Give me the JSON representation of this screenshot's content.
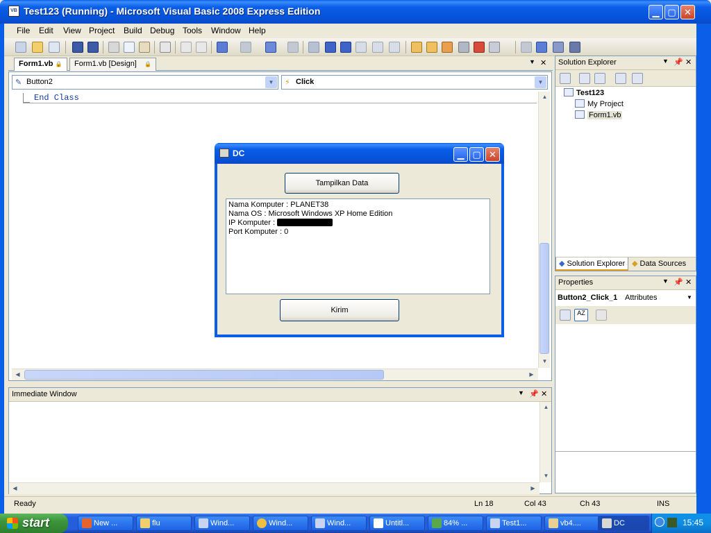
{
  "window": {
    "title": "Test123 (Running) - Microsoft Visual Basic 2008 Express Edition",
    "icon_text": "VB",
    "minimize_glyph": "▁",
    "maximize_glyph": "▢",
    "close_glyph": "✕"
  },
  "menu": [
    "File",
    "Edit",
    "View",
    "Project",
    "Build",
    "Debug",
    "Tools",
    "Window",
    "Help"
  ],
  "doc_tabs": [
    {
      "label": "Form1.vb",
      "active": true
    },
    {
      "label": "Form1.vb [Design]",
      "active": false
    }
  ],
  "editor": {
    "object_combo": "Button2",
    "event_combo": "Click",
    "code_line": "End Class"
  },
  "immediate": {
    "title": "Immediate Window"
  },
  "solution_explorer": {
    "title": "Solution Explorer",
    "project": "Test123",
    "items": [
      "My Project",
      "Form1.vb"
    ],
    "tabs": [
      "Solution Explorer",
      "Data Sources"
    ]
  },
  "properties": {
    "title": "Properties",
    "object": "Button2_Click_1",
    "type": "Attributes"
  },
  "status": {
    "text": "Ready",
    "ln": "Ln 18",
    "col": "Col 43",
    "ch": "Ch 43",
    "mode": "INS"
  },
  "dialog": {
    "title": "DC",
    "button_top": "Tampilkan Data",
    "button_bottom": "Kirim",
    "lines": {
      "name": "Nama Komputer : PLANET38",
      "os": "Nama OS : Microsoft Windows XP Home Edition",
      "ip": "IP Komputer :",
      "port": "Port Komputer : 0"
    }
  },
  "taskbar": {
    "start": "start",
    "tasks": [
      "New ...",
      "flu",
      "Wind...",
      "Wind...",
      "Wind...",
      "Untitl...",
      "84% ...",
      "Test1...",
      "vb4....",
      "DC"
    ],
    "clock": "15:45"
  }
}
